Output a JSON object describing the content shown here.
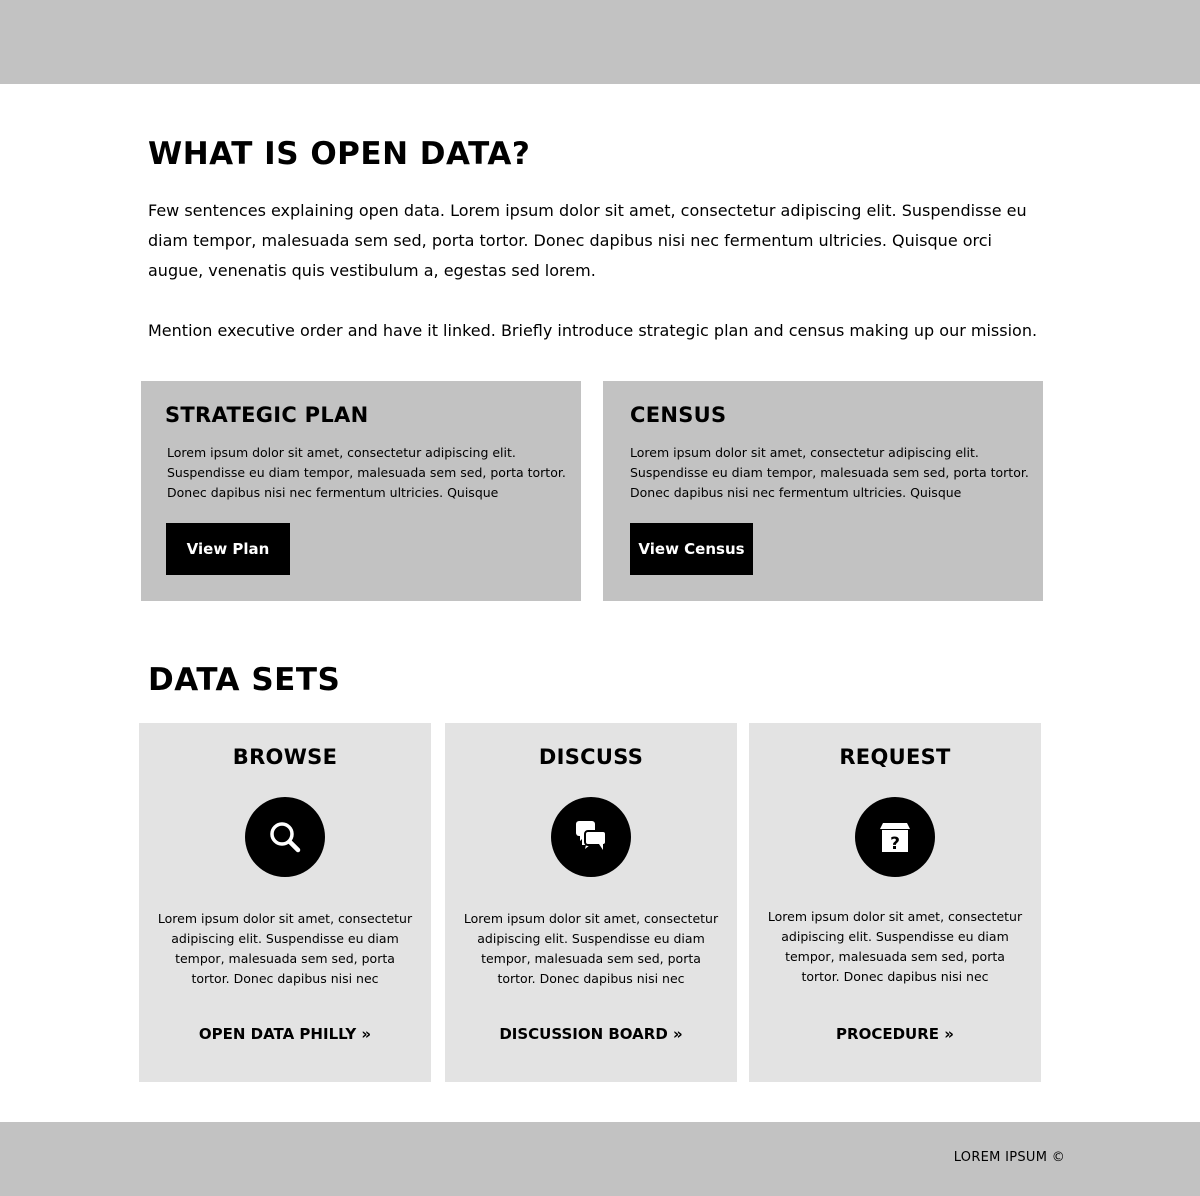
{
  "intro": {
    "title": "WHAT IS OPEN DATA?",
    "paragraph1": "Few sentences explaining open data. Lorem ipsum dolor sit amet, consectetur adipiscing elit. Suspendisse eu diam tempor, malesuada sem sed, porta tortor. Donec dapibus nisi nec fermentum ultricies. Quisque orci augue, venenatis quis vestibulum a, egestas sed lorem.",
    "paragraph2": "Mention executive order and have it linked. Briefly introduce strategic plan and census making up our mission."
  },
  "panels": [
    {
      "title": "STRATEGIC PLAN",
      "text": "Lorem ipsum dolor sit amet, consectetur adipiscing elit. Suspendisse eu diam tempor, malesuada sem sed, porta tortor. Donec dapibus nisi nec fermentum ultricies. Quisque",
      "button": "View Plan"
    },
    {
      "title": "CENSUS",
      "text": "Lorem ipsum dolor sit amet, consectetur adipiscing elit. Suspendisse eu diam tempor, malesuada sem sed, porta tortor. Donec dapibus nisi nec fermentum ultricies. Quisque",
      "button": "View Census"
    }
  ],
  "datasets": {
    "title": "DATA SETS",
    "cards": [
      {
        "title": "BROWSE",
        "icon": "search-icon",
        "text": "Lorem ipsum dolor sit amet, consectetur adipiscing elit. Suspendisse eu diam tempor, malesuada sem sed, porta tortor. Donec dapibus nisi nec",
        "link": "OPEN DATA PHILLY »"
      },
      {
        "title": "DISCUSS",
        "icon": "chat-bubbles-icon",
        "text": "Lorem ipsum dolor sit amet, consectetur adipiscing elit. Suspendisse eu diam tempor, malesuada sem sed, porta tortor. Donec dapibus nisi nec",
        "link": "DISCUSSION BOARD »"
      },
      {
        "title": "REQUEST",
        "icon": "question-box-icon",
        "text": "Lorem ipsum dolor sit amet, consectetur adipiscing elit. Suspendisse eu diam tempor, malesuada sem sed, porta tortor. Donec dapibus nisi nec",
        "link": "PROCEDURE »"
      }
    ]
  },
  "footer": {
    "text": "LOREM IPSUM ©"
  },
  "colors": {
    "bar": "#c2c2c2",
    "card": "#e3e3e3",
    "button": "#000000"
  }
}
